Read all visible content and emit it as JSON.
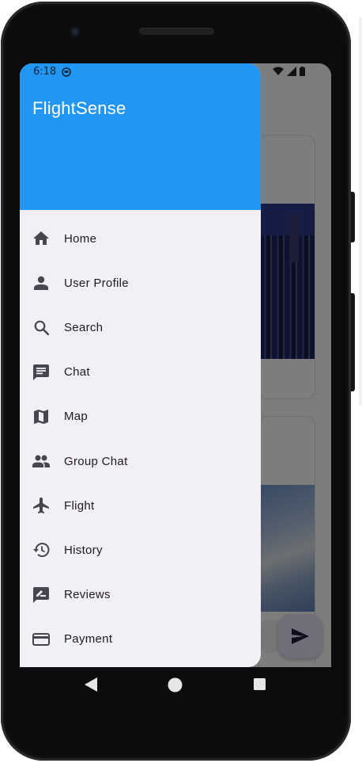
{
  "status": {
    "time": "6:18"
  },
  "drawer": {
    "title": "FlightSense",
    "items": [
      {
        "label": "Home",
        "icon": "home-icon"
      },
      {
        "label": "User Profile",
        "icon": "person-icon"
      },
      {
        "label": "Search",
        "icon": "search-icon"
      },
      {
        "label": "Chat",
        "icon": "chat-icon"
      },
      {
        "label": "Map",
        "icon": "map-icon"
      },
      {
        "label": "Group Chat",
        "icon": "group-icon"
      },
      {
        "label": "Flight",
        "icon": "airplane-icon"
      },
      {
        "label": "History",
        "icon": "history-icon"
      },
      {
        "label": "Reviews",
        "icon": "rate-review-icon"
      },
      {
        "label": "Payment",
        "icon": "credit-card-icon"
      }
    ]
  },
  "colors": {
    "header": "#2196f3",
    "drawer_bg": "#f3eff6",
    "fab": "#e3dcf5"
  }
}
